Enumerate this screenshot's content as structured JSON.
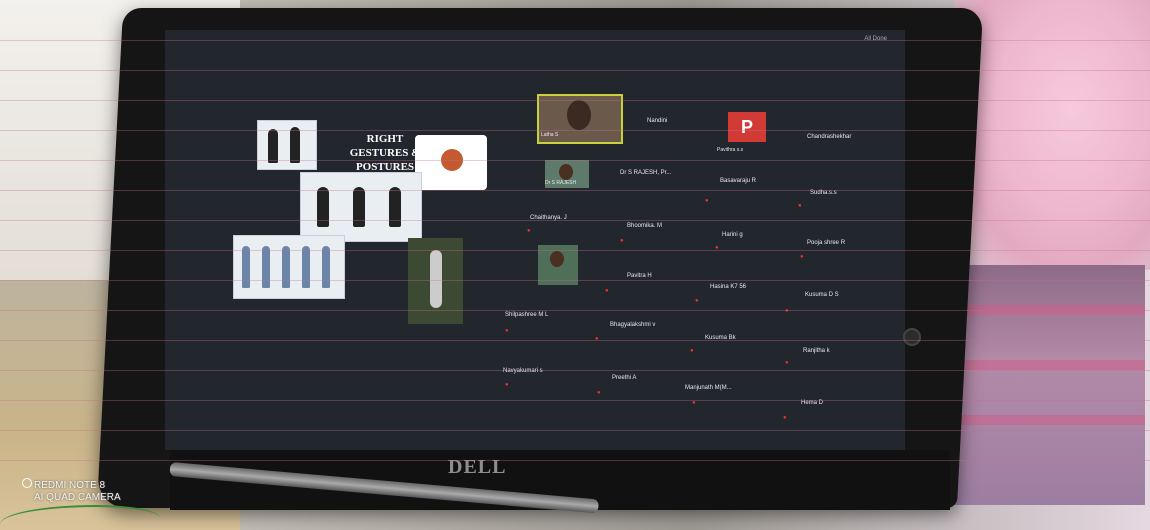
{
  "watermark": {
    "line1": "REDMI NOTE 8",
    "line2": "AI QUAD CAMERA"
  },
  "laptop": {
    "brand": "DELL"
  },
  "meeting": {
    "corner_label": "All Done"
  },
  "slide": {
    "title_line1": "RIGHT",
    "title_line2": "GESTURES &",
    "title_line3": "POSTURES"
  },
  "participants": [
    {
      "name": "Latha S"
    },
    {
      "name": "Nandini"
    },
    {
      "name": "Pavithra s.s"
    },
    {
      "name": "Chandrashekhar"
    },
    {
      "name": "Dr S RAJESH"
    },
    {
      "name": "Dr S RAJESH, Pr..."
    },
    {
      "name": "Basavaraju R"
    },
    {
      "name": "Sudha.s.s"
    },
    {
      "name": "Chaithanya. J"
    },
    {
      "name": "Bhoomika. M"
    },
    {
      "name": "Harini g"
    },
    {
      "name": "Pooja shree R"
    },
    {
      "name": "Pavitra H"
    },
    {
      "name": "Hasina K7 56"
    },
    {
      "name": "Kusuma D S"
    },
    {
      "name": "Shilpashree M L"
    },
    {
      "name": "Bhagyalakshmi v"
    },
    {
      "name": "Kusuma Bk"
    },
    {
      "name": "Ranjitha k"
    },
    {
      "name": "Navyakumari s"
    },
    {
      "name": "Preethi A"
    },
    {
      "name": "Manjunath M(M..."
    },
    {
      "name": "Hema D"
    }
  ],
  "avatar_letter": "P",
  "colors": {
    "screen_bg": "#22262d",
    "active_speaker_border": "#c8d23a",
    "avatar_bg": "#d23b35",
    "mic_muted": "#e33"
  },
  "icons": {
    "mic_muted": "mic-muted-icon"
  }
}
